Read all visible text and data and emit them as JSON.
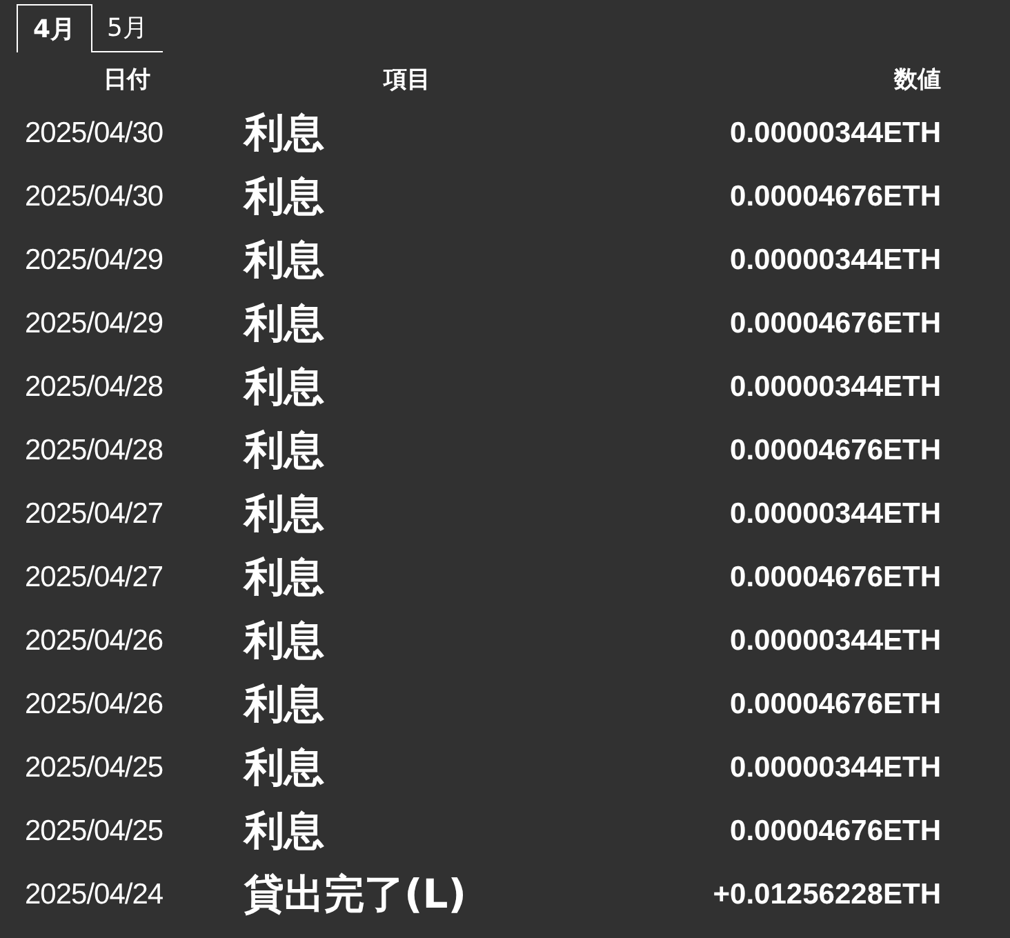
{
  "tabs": [
    {
      "label": "4月",
      "selected": true
    },
    {
      "label": "5月",
      "selected": false
    }
  ],
  "table": {
    "columns": [
      "日付",
      "項目",
      "数値"
    ],
    "rows": [
      {
        "date": "2025/04/30",
        "item": "利息",
        "value": "0.00000344ETH"
      },
      {
        "date": "2025/04/30",
        "item": "利息",
        "value": "0.00004676ETH"
      },
      {
        "date": "2025/04/29",
        "item": "利息",
        "value": "0.00000344ETH"
      },
      {
        "date": "2025/04/29",
        "item": "利息",
        "value": "0.00004676ETH"
      },
      {
        "date": "2025/04/28",
        "item": "利息",
        "value": "0.00000344ETH"
      },
      {
        "date": "2025/04/28",
        "item": "利息",
        "value": "0.00004676ETH"
      },
      {
        "date": "2025/04/27",
        "item": "利息",
        "value": "0.00000344ETH"
      },
      {
        "date": "2025/04/27",
        "item": "利息",
        "value": "0.00004676ETH"
      },
      {
        "date": "2025/04/26",
        "item": "利息",
        "value": "0.00000344ETH"
      },
      {
        "date": "2025/04/26",
        "item": "利息",
        "value": "0.00004676ETH"
      },
      {
        "date": "2025/04/25",
        "item": "利息",
        "value": "0.00000344ETH"
      },
      {
        "date": "2025/04/25",
        "item": "利息",
        "value": "0.00004676ETH"
      },
      {
        "date": "2025/04/24",
        "item": "貸出完了(L)",
        "value": "+0.01256228ETH"
      }
    ]
  }
}
